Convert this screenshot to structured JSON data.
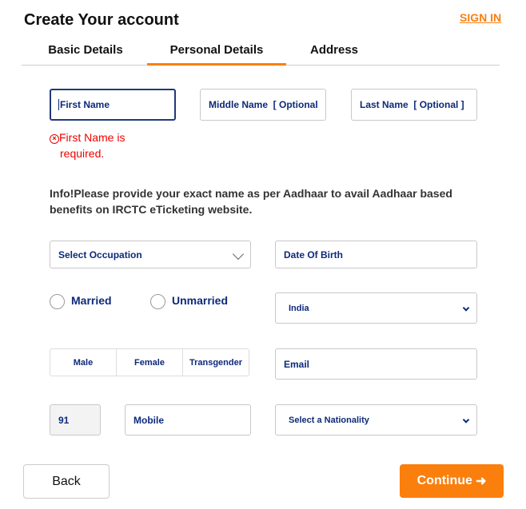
{
  "header": {
    "title": "Create Your account",
    "sign_in": "SIGN IN"
  },
  "tabs": [
    {
      "label": "Basic Details"
    },
    {
      "label": "Personal Details",
      "active": true
    },
    {
      "label": "Address"
    }
  ],
  "form": {
    "first_name": {
      "placeholder": "First Name",
      "error": "First Name is required."
    },
    "middle_name": {
      "placeholder": "Middle Name  [ Optional"
    },
    "last_name": {
      "placeholder": "Last Name  [ Optional ]"
    },
    "info": "Info!Please provide your exact name as per Aadhaar to avail Aadhaar based benefits on IRCTC eTicketing website.",
    "occupation": {
      "value": "Select Occupation"
    },
    "dob": {
      "placeholder": "Date Of Birth"
    },
    "marital": [
      {
        "label": "Married",
        "selected": false
      },
      {
        "label": "Unmarried",
        "selected": false
      }
    ],
    "country": {
      "value": "India"
    },
    "gender": [
      {
        "label": "Male"
      },
      {
        "label": "Female"
      },
      {
        "label": "Transgender"
      }
    ],
    "email": {
      "placeholder": "Email"
    },
    "country_code": "91",
    "mobile": {
      "placeholder": "Mobile"
    },
    "nationality": {
      "value": "Select a Nationality"
    }
  },
  "buttons": {
    "back": "Back",
    "continue": "Continue"
  },
  "colors": {
    "accent": "#fb7f0d",
    "text_blue": "#0d2a7a",
    "error": "#e00000"
  }
}
